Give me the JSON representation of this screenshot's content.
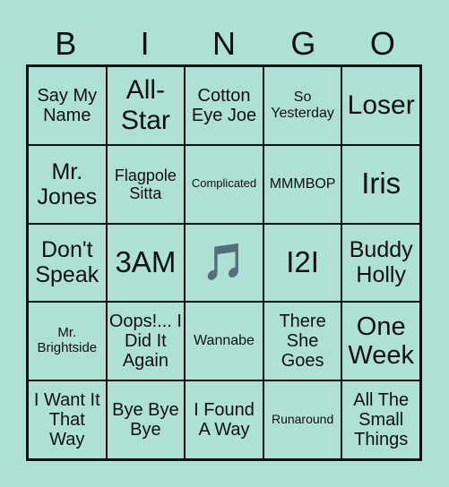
{
  "header": [
    "B",
    "I",
    "N",
    "G",
    "O"
  ],
  "cells": [
    [
      "Say My Name",
      "All-Star",
      "Cotton Eye Joe",
      "So Yesterday",
      "Loser"
    ],
    [
      "Mr. Jones",
      "Flagpole Sitta",
      "Complicated",
      "MMMBOP",
      "Iris"
    ],
    [
      "Don't Speak",
      "3AM",
      "🎵",
      "I2I",
      "Buddy Holly"
    ],
    [
      "Mr. Brightside",
      "Oops!... I Did It Again",
      "Wannabe",
      "There She Goes",
      "One Week"
    ],
    [
      "I Want It That Way",
      "Bye Bye Bye",
      "I Found A Way",
      "Runaround",
      "All The Small Things"
    ]
  ],
  "free_icon": "music-note-icon"
}
